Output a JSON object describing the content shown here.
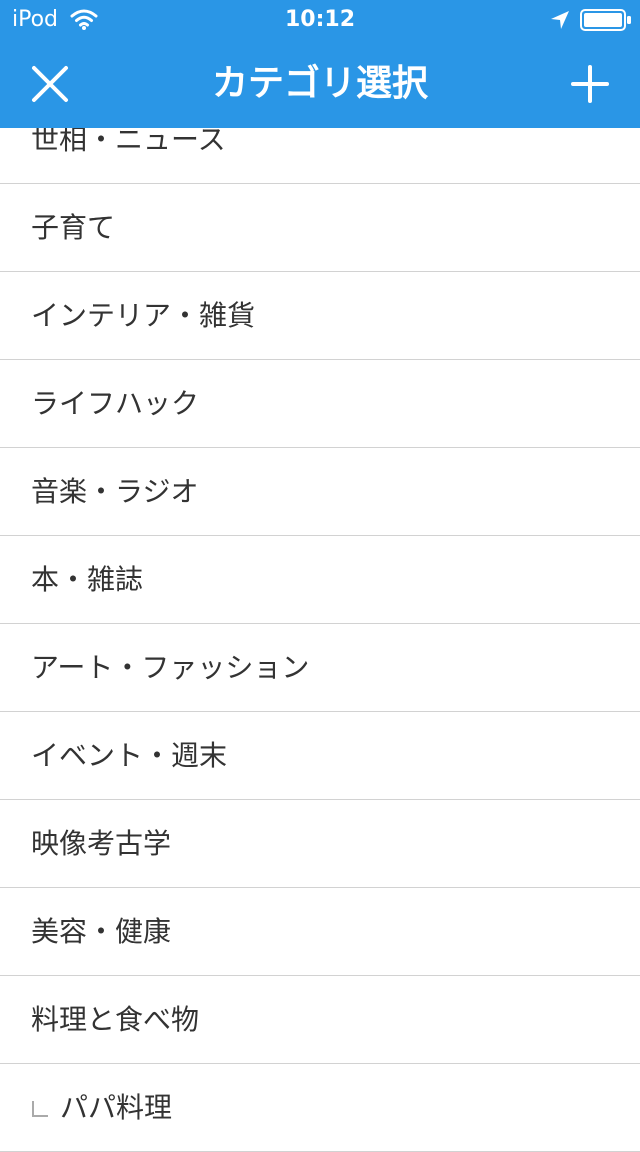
{
  "status_bar": {
    "carrier": "iPod",
    "time": "10:12"
  },
  "navbar": {
    "title": "カテゴリ選択"
  },
  "categories": [
    "世相・ニュース",
    "子育て",
    "インテリア・雑貨",
    "ライフハック",
    "音楽・ラジオ",
    "本・雑誌",
    "アート・ファッション",
    "イベント・週末",
    "映像考古学",
    "美容・健康",
    "料理と食べ物",
    "パパ料理"
  ],
  "colors": {
    "header_bg": "#2a96e6",
    "header_text": "#ffffff",
    "item_text": "#333333",
    "divider": "#d2d2d2"
  },
  "icons": {
    "close": "close-icon",
    "add": "plus-icon",
    "wifi": "wifi-icon",
    "location": "location-arrow-icon",
    "battery": "battery-icon"
  }
}
